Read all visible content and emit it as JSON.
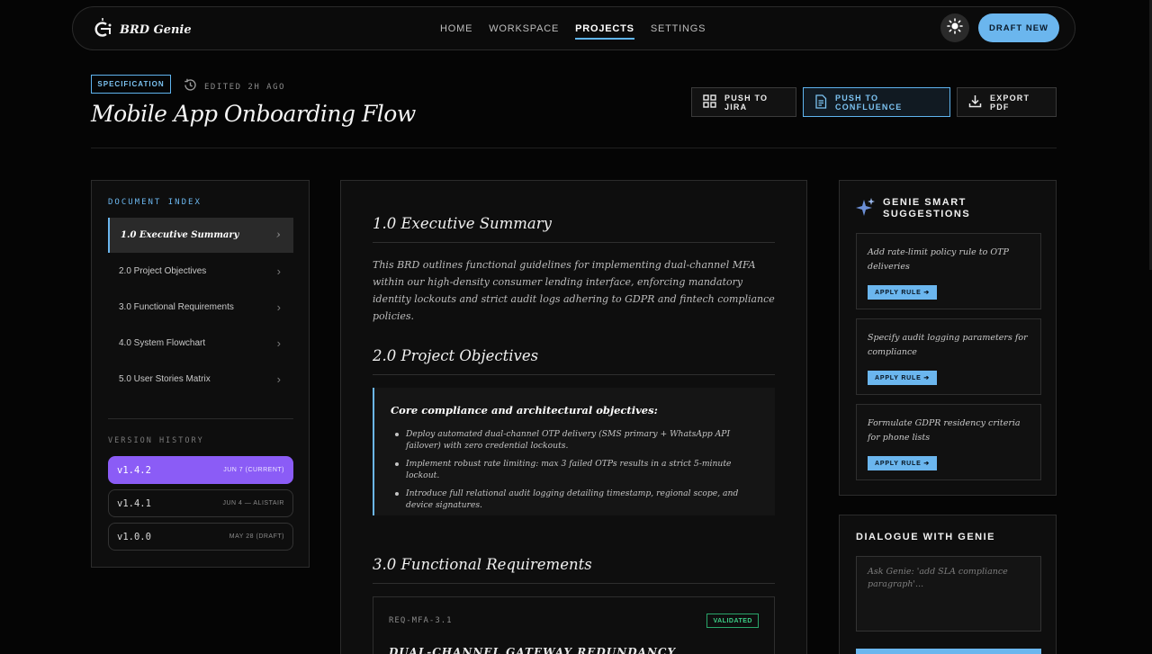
{
  "nav": {
    "brand": "BRD Genie",
    "links": [
      {
        "label": "HOME",
        "active": false
      },
      {
        "label": "WORKSPACE",
        "active": false
      },
      {
        "label": "PROJECTS",
        "active": true
      },
      {
        "label": "SETTINGS",
        "active": false
      }
    ],
    "theme_icon": "sun-icon",
    "draft_label": "DRAFT NEW"
  },
  "header": {
    "badge": "SPECIFICATION",
    "edited": "EDITED 2H AGO",
    "title": "Mobile App Onboarding Flow",
    "actions": {
      "jira": "PUSH TO JIRA",
      "confluence": "PUSH TO CONFLUENCE",
      "pdf": "EXPORT PDF"
    }
  },
  "sidebar": {
    "heading": "DOCUMENT INDEX",
    "items": [
      {
        "label": "1.0 Executive Summary",
        "active": true
      },
      {
        "label": "2.0 Project Objectives",
        "active": false
      },
      {
        "label": "3.0 Functional Requirements",
        "active": false
      },
      {
        "label": "4.0 System Flowchart",
        "active": false
      },
      {
        "label": "5.0 User Stories Matrix",
        "active": false
      }
    ],
    "version_heading": "VERSION HISTORY",
    "versions": [
      {
        "version": "v1.4.2",
        "date": "JUN 7 (CURRENT)",
        "current": true
      },
      {
        "version": "v1.4.1",
        "date": "JUN 4 — ALISTAIR",
        "current": false
      },
      {
        "version": "v1.0.0",
        "date": "MAY 28 (DRAFT)",
        "current": false
      }
    ]
  },
  "doc": {
    "sections": [
      {
        "title": "1.0 Executive Summary"
      },
      {
        "title": "2.0 Project Objectives"
      },
      {
        "title": "3.0 Functional Requirements"
      }
    ],
    "summary": "This BRD outlines functional guidelines for implementing dual-channel MFA within our high-density consumer lending interface, enforcing mandatory identity lockouts and strict audit logs adhering to GDPR and fintech compliance policies.",
    "callout": {
      "title": "Core compliance and architectural objectives:",
      "bullets": [
        "Deploy automated dual-channel OTP delivery (SMS primary + WhatsApp API failover) with zero credential lockouts.",
        "Implement robust rate limiting: max 3 failed OTPs results in a strict 5-minute lockout.",
        "Introduce full relational audit logging detailing timestamp, regional scope, and device signatures."
      ]
    },
    "requirement": {
      "id": "REQ-MFA-3.1",
      "status": "VALIDATED",
      "title": "DUAL-CHANNEL GATEWAY REDUNDANCY"
    }
  },
  "suggestions": {
    "title": "GENIE SMART SUGGESTIONS",
    "apply_label": "APPLY RULE ➔",
    "items": [
      {
        "text": "Add rate-limit policy rule to OTP deliveries"
      },
      {
        "text": "Specify audit logging parameters for compliance"
      },
      {
        "text": "Formulate GDPR residency criteria for phone lists"
      }
    ]
  },
  "dialogue": {
    "title": "DIALOGUE WITH GENIE",
    "placeholder": "Ask Genie: 'add SLA compliance paragraph'..."
  },
  "colors": {
    "accent": "#6bb6ee",
    "current_version": "#8b5cf6",
    "validated": "#3ccf86",
    "background": "#050505"
  }
}
